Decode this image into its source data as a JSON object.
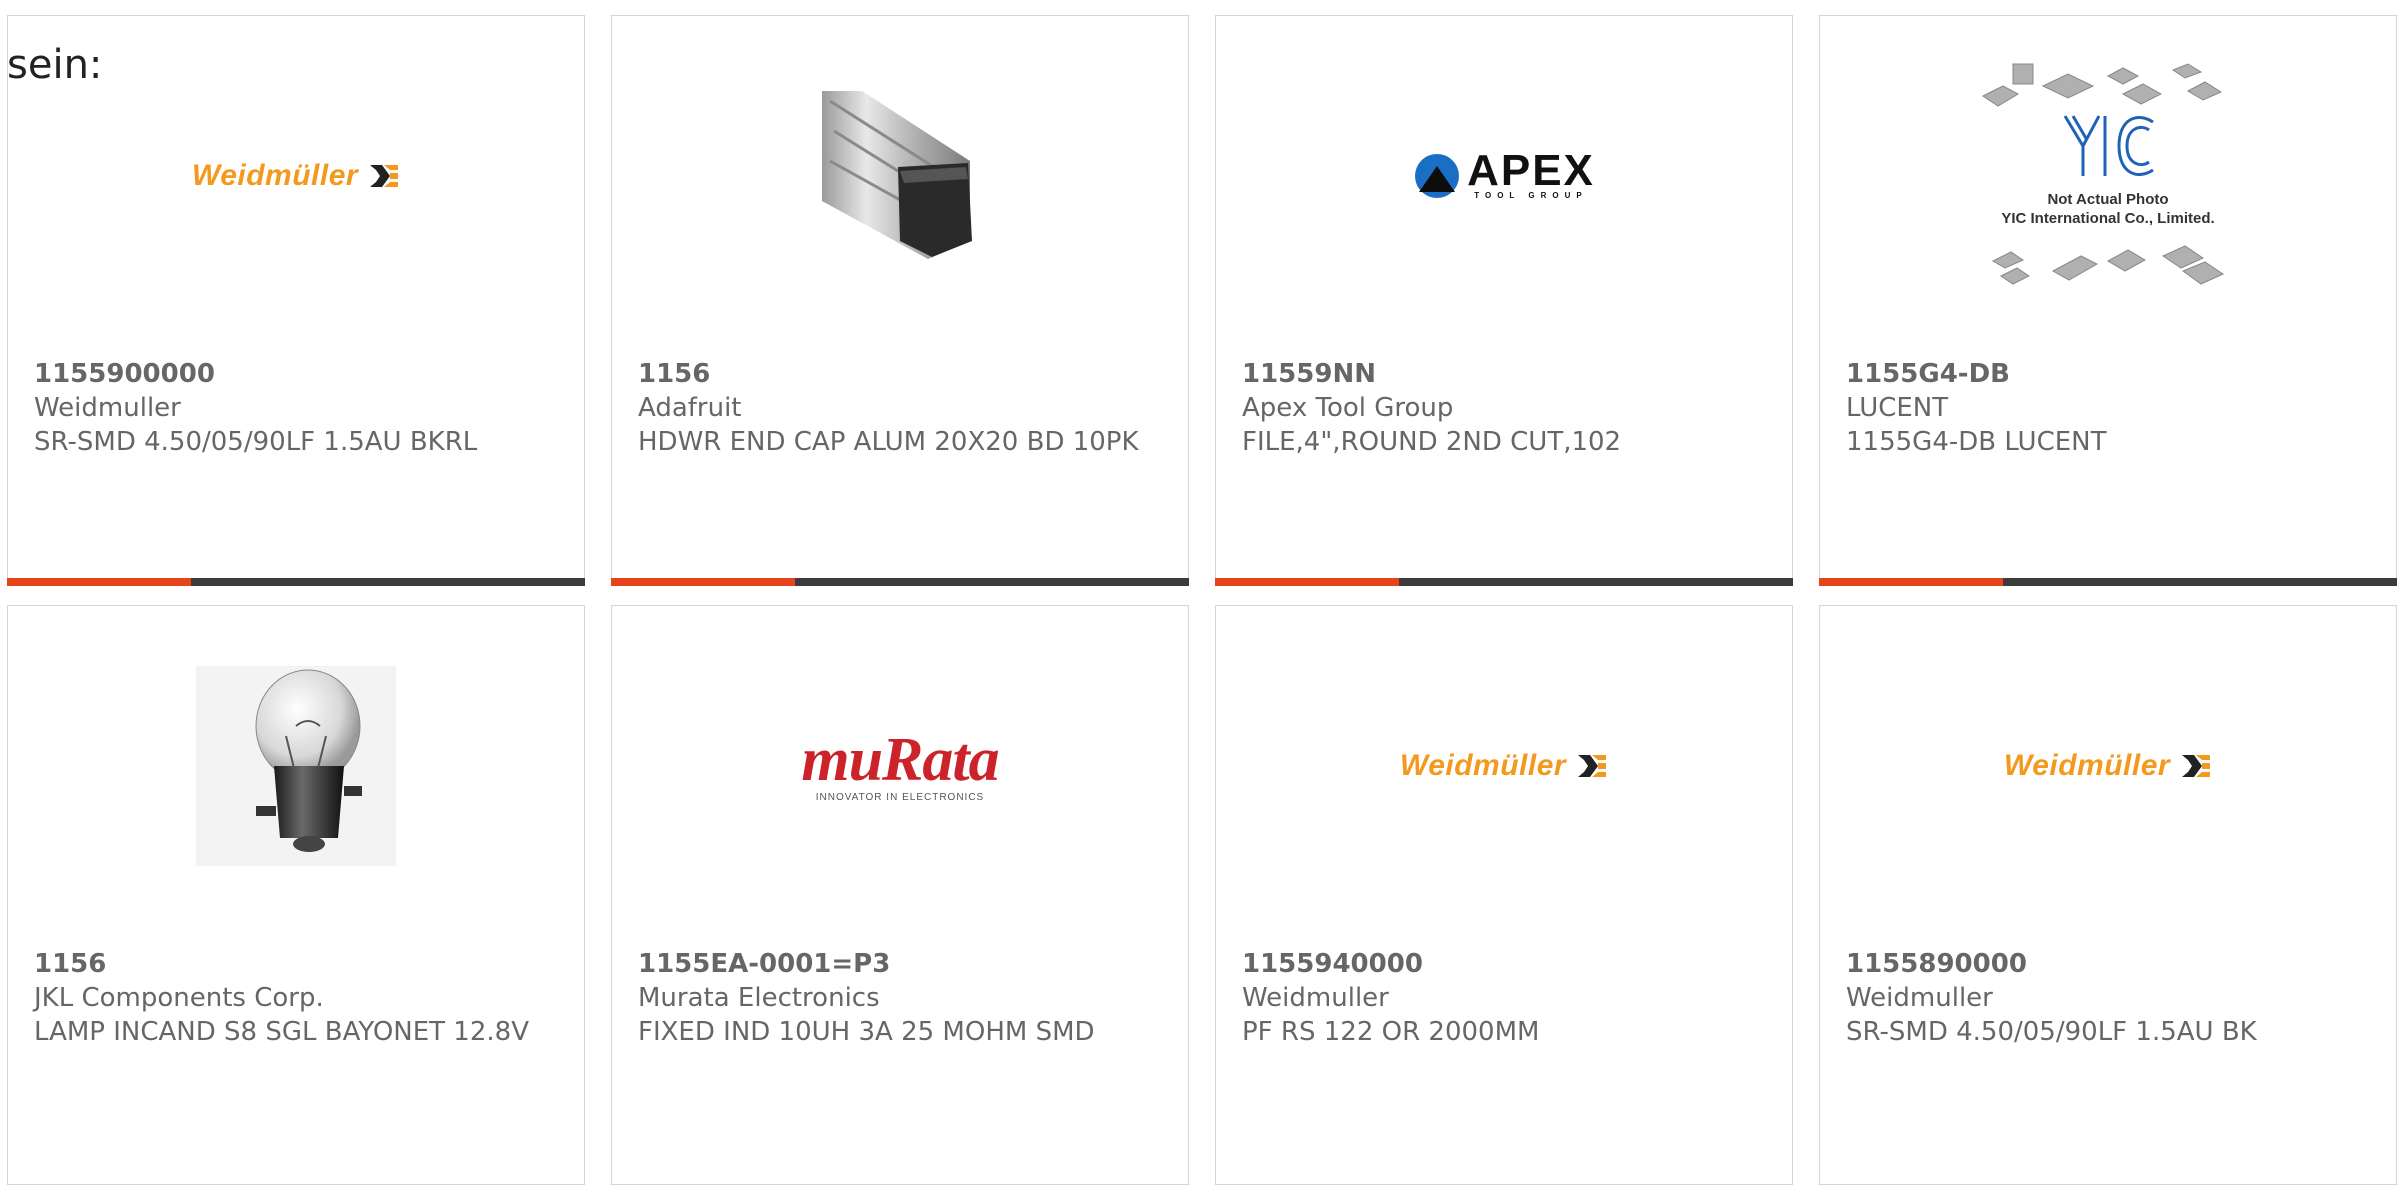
{
  "prefix_text": "sein:",
  "colors": {
    "accent": "#e8441c",
    "bar": "#3c3c3c",
    "card_border": "#d6d6d6",
    "text": "#666666"
  },
  "products": [
    {
      "part_number": "1155900000",
      "manufacturer": "Weidmuller",
      "description": "SR-SMD 4.50/05/90LF 1.5AU BKRL",
      "image": "weidmuller-logo",
      "logo_text": "Weidmüller"
    },
    {
      "part_number": "1156",
      "manufacturer": "Adafruit",
      "description": "HDWR END CAP ALUM 20X20 BD 10PK",
      "image": "aluminum-extrusion-end-cap-photo"
    },
    {
      "part_number": "11559NN",
      "manufacturer": "Apex Tool Group",
      "description": "FILE,4\",ROUND 2ND CUT,102",
      "image": "apex-tool-group-logo",
      "logo_text": "APEX",
      "logo_subtext": "TOOL GROUP"
    },
    {
      "part_number": "1155G4-DB",
      "manufacturer": "LUCENT",
      "description": "1155G4-DB LUCENT",
      "image": "yic-not-actual-photo",
      "logo_caption_1": "Not Actual Photo",
      "logo_caption_2": "YIC International Co., Limited."
    },
    {
      "part_number": "1156",
      "manufacturer": "JKL Components Corp.",
      "description": "LAMP INCAND S8 SGL BAYONET 12.8V",
      "image": "incandescent-lamp-photo"
    },
    {
      "part_number": "1155EA-0001=P3",
      "manufacturer": "Murata Electronics",
      "description": "FIXED IND 10UH 3A 25 MOHM SMD",
      "image": "murata-logo",
      "logo_text": "muRata",
      "logo_subtext": "INNOVATOR IN ELECTRONICS"
    },
    {
      "part_number": "1155940000",
      "manufacturer": "Weidmuller",
      "description": "PF RS 122 OR 2000MM",
      "image": "weidmuller-logo",
      "logo_text": "Weidmüller"
    },
    {
      "part_number": "1155890000",
      "manufacturer": "Weidmuller",
      "description": "SR-SMD 4.50/05/90LF 1.5AU BK",
      "image": "weidmuller-logo",
      "logo_text": "Weidmüller"
    }
  ]
}
